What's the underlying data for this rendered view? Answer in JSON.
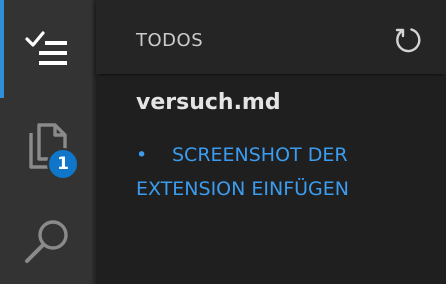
{
  "activity_bar": {
    "items": [
      {
        "id": "todos",
        "icon": "checklist-icon",
        "active": true
      },
      {
        "id": "explorer",
        "icon": "files-icon",
        "badge": "1"
      },
      {
        "id": "search",
        "icon": "search-icon"
      }
    ],
    "active_color": "#2f8fd8",
    "badge_color": "#1076c9"
  },
  "panel": {
    "title": "TODOS",
    "refresh_icon": "refresh-icon",
    "file": {
      "name": "versuch.md",
      "todos": [
        {
          "bullet": "•",
          "text": "SCREENSHOT DER EXTENSION EINFÜGEN"
        }
      ]
    },
    "todo_color": "#3b9cf0"
  }
}
